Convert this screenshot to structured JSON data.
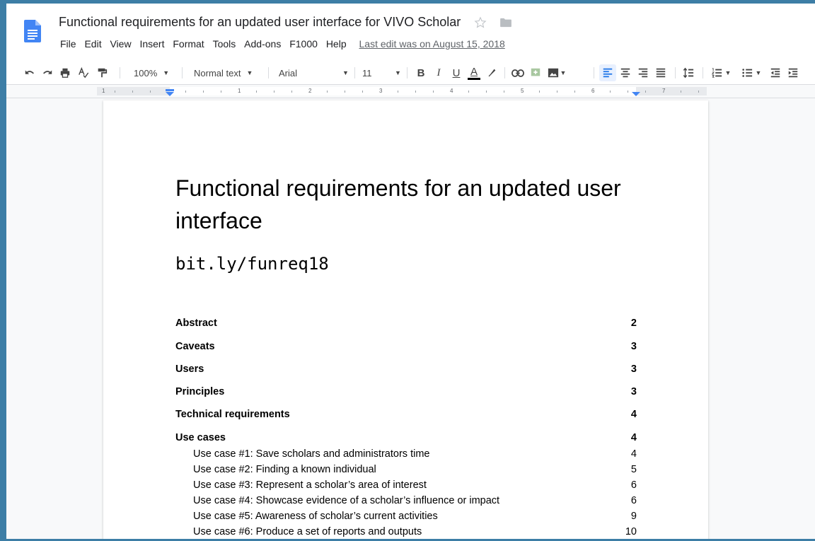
{
  "header": {
    "title": "Functional requirements for an updated user interface for VIVO Scholar",
    "menu": [
      "File",
      "Edit",
      "View",
      "Insert",
      "Format",
      "Tools",
      "Add-ons",
      "F1000",
      "Help"
    ],
    "last_edit": "Last edit was on August 15, 2018"
  },
  "toolbar": {
    "zoom": "100%",
    "style": "Normal text",
    "font": "Arial",
    "size": "11",
    "bold_label": "B",
    "italic_label": "I",
    "underline_label": "U",
    "text_color_label": "A",
    "text_color": "#000000"
  },
  "ruler": {
    "numbers": [
      "1",
      "1",
      "2",
      "3",
      "4",
      "5",
      "6",
      "7"
    ]
  },
  "document": {
    "heading": "Functional requirements for an updated user interface",
    "subtitle": "bit.ly/funreq18",
    "toc": [
      {
        "title": "Abstract",
        "page": "2",
        "level": 1
      },
      {
        "title": "Caveats",
        "page": "3",
        "level": 1
      },
      {
        "title": "Users",
        "page": "3",
        "level": 1
      },
      {
        "title": "Principles",
        "page": "3",
        "level": 1
      },
      {
        "title": "Technical requirements",
        "page": "4",
        "level": 1
      },
      {
        "title": "Use cases",
        "page": "4",
        "level": 1
      },
      {
        "title": "Use case #1: Save scholars and administrators time",
        "page": "4",
        "level": 2
      },
      {
        "title": "Use case #2: Finding a known individual",
        "page": "5",
        "level": 2
      },
      {
        "title": "Use case #3: Represent a scholar’s area of interest",
        "page": "6",
        "level": 2
      },
      {
        "title": "Use case #4: Showcase evidence of a scholar’s influence or impact",
        "page": "6",
        "level": 2
      },
      {
        "title": "Use case #5: Awareness of scholar’s current activities",
        "page": "9",
        "level": 2
      },
      {
        "title": "Use case #6: Produce a set of reports and outputs",
        "page": "10",
        "level": 2
      }
    ]
  },
  "colors": {
    "outer_border": "#3d7ea6",
    "docs_blue": "#4285f4",
    "active_button": "#e8f0fe"
  }
}
